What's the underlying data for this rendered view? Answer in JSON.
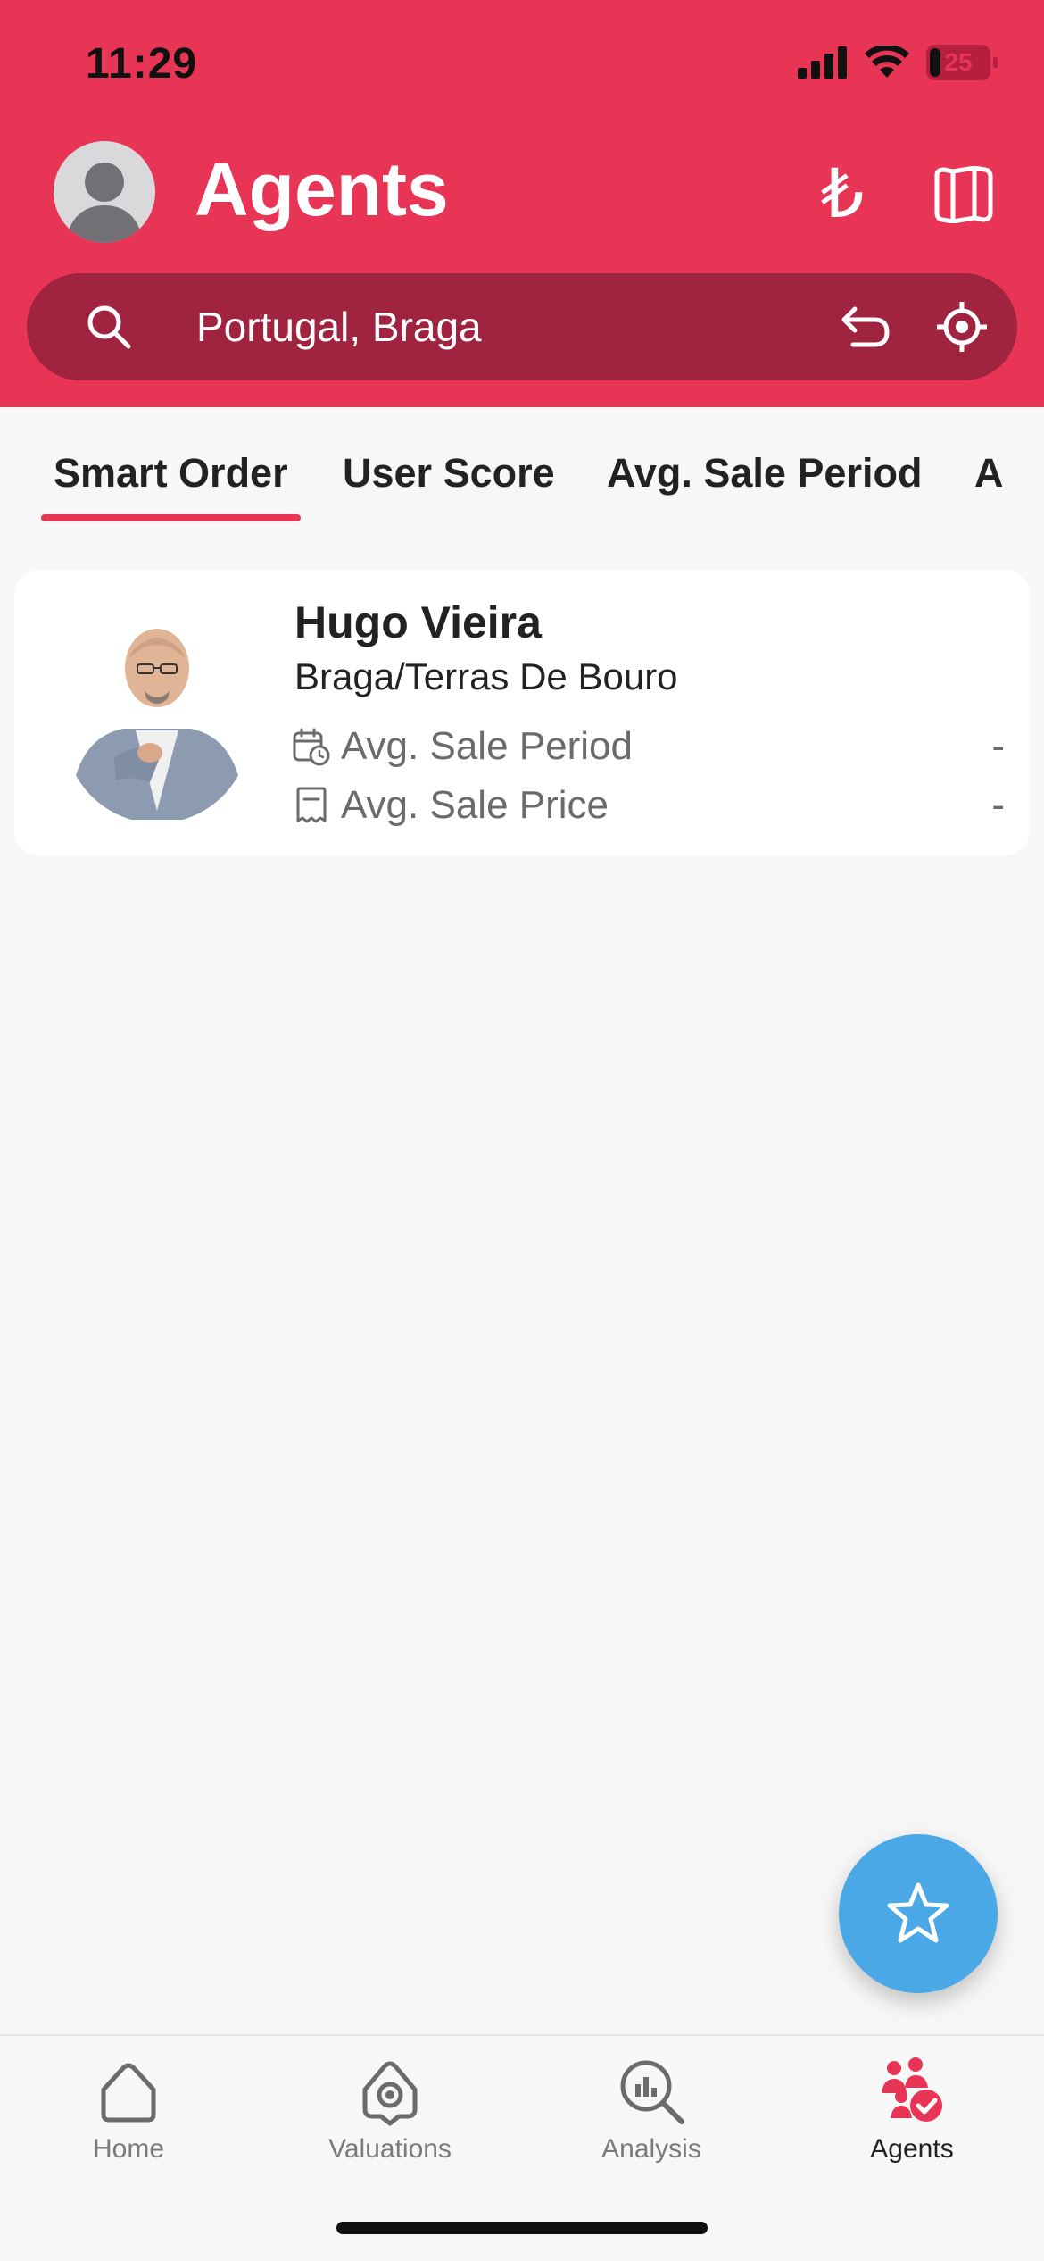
{
  "status_bar": {
    "time": "11:29",
    "battery": "25"
  },
  "header": {
    "title": "Agents",
    "currency_symbol": "₺"
  },
  "search": {
    "value": "Portugal, Braga"
  },
  "tabs": [
    {
      "label": "Smart Order",
      "active": true
    },
    {
      "label": "User Score",
      "active": false
    },
    {
      "label": "Avg. Sale Period",
      "active": false
    },
    {
      "label": "A",
      "active": false
    }
  ],
  "agents": [
    {
      "name": "Hugo Vieira",
      "region": "Braga/Terras De Bouro",
      "stats": [
        {
          "label": "Avg. Sale Period",
          "value": "-",
          "icon": "calendar-clock-icon"
        },
        {
          "label": "Avg. Sale Price",
          "value": "-",
          "icon": "receipt-icon"
        }
      ]
    }
  ],
  "bottom_nav": [
    {
      "label": "Home",
      "icon": "home-icon",
      "active": false
    },
    {
      "label": "Valuations",
      "icon": "location-shield-icon",
      "active": false
    },
    {
      "label": "Analysis",
      "icon": "search-chart-icon",
      "active": false
    },
    {
      "label": "Agents",
      "icon": "agents-icon",
      "active": true
    }
  ],
  "colors": {
    "brand": "#e83556",
    "search_bg": "#a0233f",
    "fab": "#4aa8e6",
    "background": "#f7f7f7"
  }
}
